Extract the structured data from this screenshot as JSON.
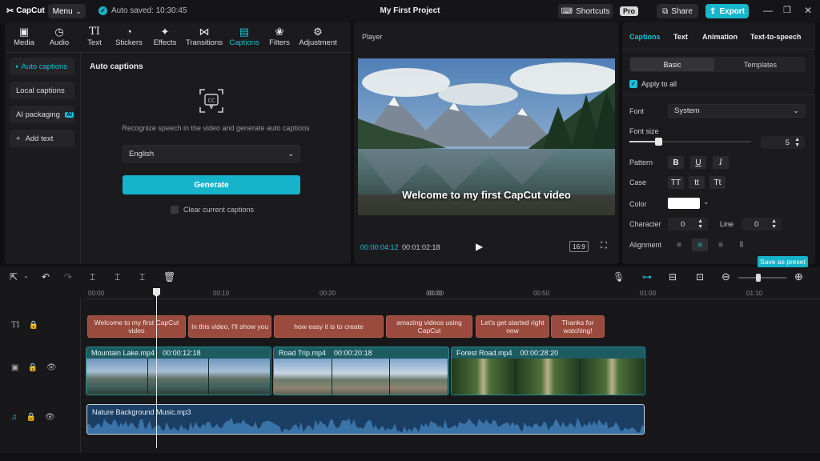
{
  "app": {
    "name": "CapCut",
    "menu_label": "Menu",
    "autosave": "Auto saved: 10:30:45",
    "project_title": "My First Project"
  },
  "header": {
    "shortcuts": "Shortcuts",
    "pro": "Pro",
    "share": "Share",
    "export": "Export"
  },
  "toolbar": [
    {
      "label": "Media",
      "icon": "media-icon"
    },
    {
      "label": "Audio",
      "icon": "audio-icon"
    },
    {
      "label": "Text",
      "icon": "text-icon"
    },
    {
      "label": "Stickers",
      "icon": "stickers-icon"
    },
    {
      "label": "Effects",
      "icon": "effects-icon"
    },
    {
      "label": "Transitions",
      "icon": "transitions-icon"
    },
    {
      "label": "Captions",
      "icon": "captions-icon"
    },
    {
      "label": "Filters",
      "icon": "filters-icon"
    },
    {
      "label": "Adjustment",
      "icon": "adjustment-icon"
    }
  ],
  "sidenav": {
    "auto": "Auto captions",
    "local": "Local captions",
    "ai": "AI packaging",
    "ai_badge": "AI",
    "add": "Add text"
  },
  "captions_panel": {
    "title": "Auto captions",
    "description": "Recognize speech in the video and generate auto captions",
    "language": "English",
    "generate": "Generate",
    "clear": "Clear current captions"
  },
  "player": {
    "title": "Player",
    "caption": "Welcome to my first CapCut video",
    "current_time": "00:00:04:12",
    "total_time": "00:01:02:18",
    "ratio": "16:9"
  },
  "right_panel": {
    "tabs": [
      "Captions",
      "Text",
      "Animation",
      "Text-to-speech"
    ],
    "subtabs": [
      "Basic",
      "Templates"
    ],
    "apply_all": "Apply to all",
    "font_label": "Font",
    "font_value": "System",
    "font_size_label": "Font size",
    "font_size_value": "5",
    "font_size_fraction": 0.24,
    "pattern_label": "Pattern",
    "pattern_opts": [
      "B",
      "U",
      "I"
    ],
    "case_label": "Case",
    "case_opts": [
      "TT",
      "tt",
      "Tt"
    ],
    "color_label": "Color",
    "color_value": "#ffffff",
    "character_label": "Character",
    "character_value": "0",
    "line_label": "Line",
    "line_value": "0",
    "alignment_label": "Alignment",
    "save_preset": "Save as preset"
  },
  "ruler": [
    "00:00",
    "00:10",
    "00:20",
    "00:30",
    "00:40",
    "00:50",
    "01:00",
    "01:10"
  ],
  "captions_track": [
    {
      "text": "Welcome to my first CapCut video"
    },
    {
      "text": "In this video, I'll show you"
    },
    {
      "text": "how easy it is to create"
    },
    {
      "text": "amazing videos using CapCut"
    },
    {
      "text": "Let's get started right now"
    },
    {
      "text": "Thanks for watching!"
    }
  ],
  "video_track": [
    {
      "name": "Mountain Lake.mp4",
      "duration": "00:00:12:18"
    },
    {
      "name": "Road Trip.mp4",
      "duration": "00:00:20:18"
    },
    {
      "name": "Forest Road.mp4",
      "duration": "00:00:28:20"
    }
  ],
  "audio_track": {
    "name": "Nature Background Music.mp3"
  },
  "colors": {
    "accent": "#19c1d8",
    "caption_clip": "#9a4b3d",
    "video_clip": "#1c5b60",
    "audio_clip": "#1a3e64"
  }
}
